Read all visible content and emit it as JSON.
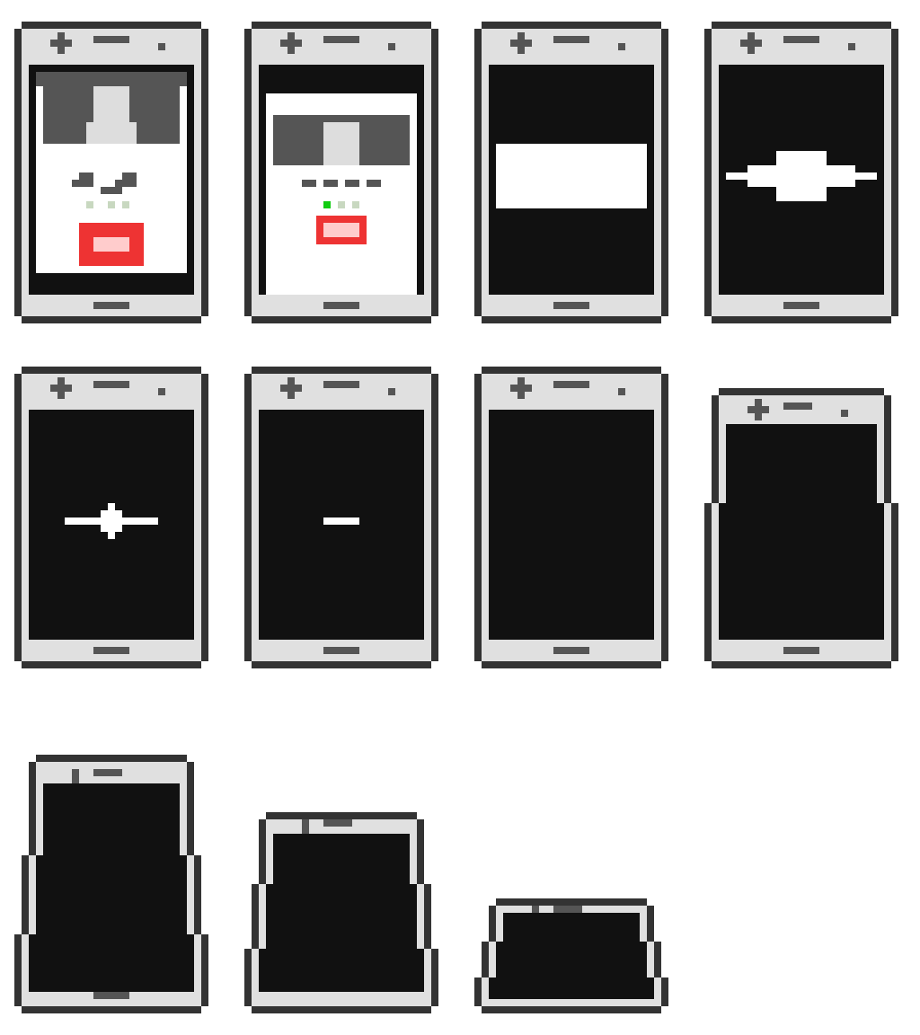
{
  "sprite_sheet": {
    "description_hidden": "",
    "colors": {
      "outline": "#333333",
      "body": "#e0e0e0",
      "screen_off": "#111111",
      "screen_on": "#ffffff",
      "ui_dark": "#555555",
      "avatar_face": "#dddddd",
      "decline_red": "#ee3333",
      "decline_light": "#ffcccc",
      "dot_idle": "#c8d8c0",
      "dot_active": "#11cc11",
      "header_bar": "#555555"
    },
    "frames": [
      {
        "id": 1,
        "state": "incoming-call",
        "screen": "call",
        "screen_fill": 1.0
      },
      {
        "id": 2,
        "state": "call-shrinking",
        "screen": "call-small",
        "screen_fill": 0.8
      },
      {
        "id": 3,
        "state": "screen-collapsing",
        "screen": "white-bar",
        "screen_fill": 0.4
      },
      {
        "id": 4,
        "state": "screen-collapsing",
        "screen": "white-line-diamond",
        "screen_fill": 0.2
      },
      {
        "id": 5,
        "state": "screen-collapsing",
        "screen": "white-line-dot",
        "screen_fill": 0.1
      },
      {
        "id": 6,
        "state": "screen-collapsing",
        "screen": "white-dash",
        "screen_fill": 0.05
      },
      {
        "id": 7,
        "state": "screen-off",
        "screen": "off",
        "screen_fill": 0
      },
      {
        "id": 8,
        "state": "phone-squash",
        "screen": "off",
        "squash": 0.92
      },
      {
        "id": 9,
        "state": "phone-squash",
        "screen": "off",
        "squash": 0.86
      },
      {
        "id": 10,
        "state": "phone-squash",
        "screen": "off",
        "squash": 0.65
      },
      {
        "id": 11,
        "state": "phone-squash",
        "screen": "off",
        "squash": 0.38
      }
    ]
  }
}
